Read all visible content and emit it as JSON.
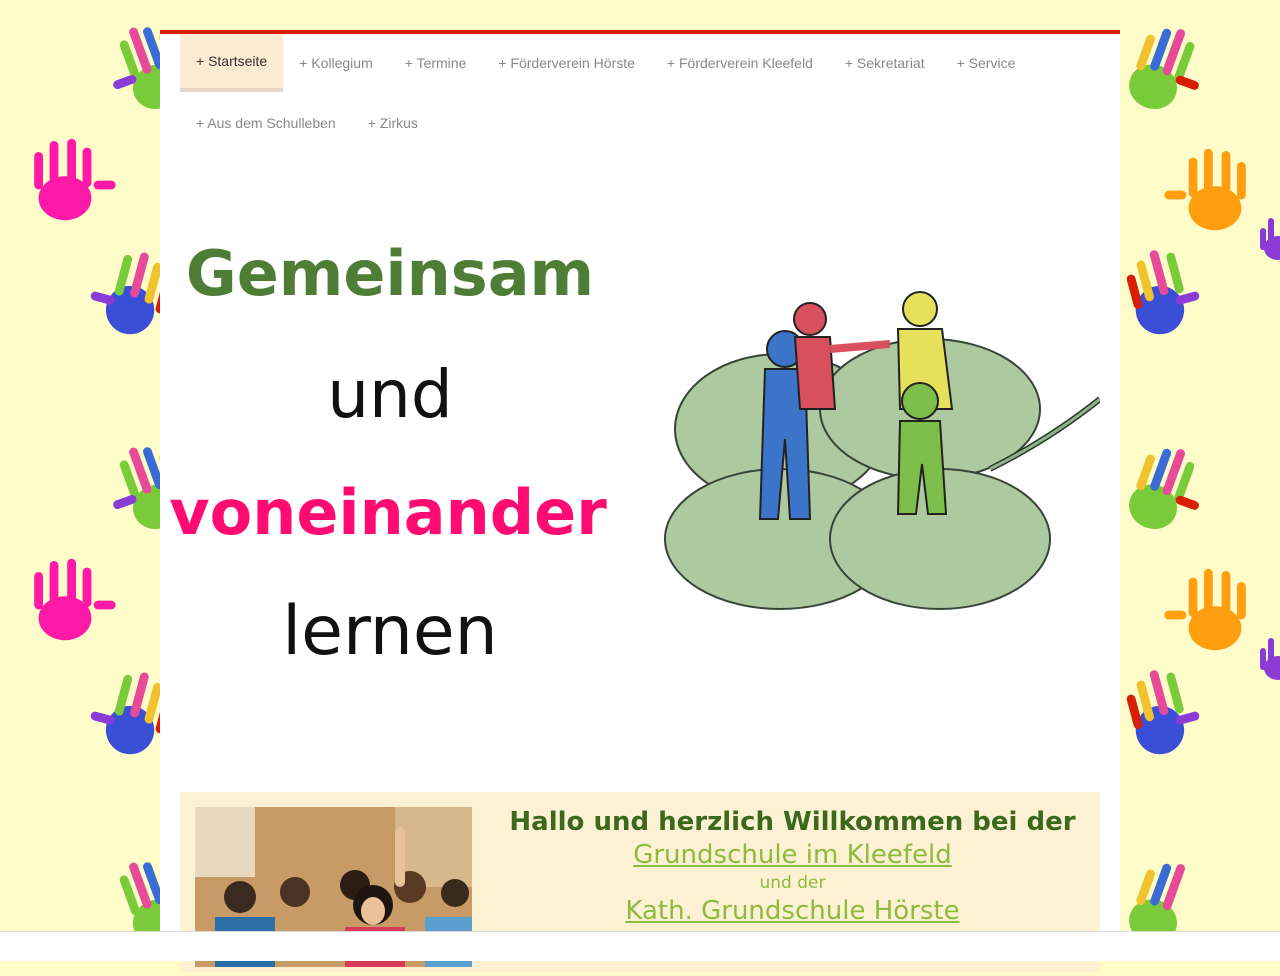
{
  "nav": {
    "items": [
      {
        "label": "+ Startseite",
        "active": true
      },
      {
        "label": "+ Kollegium"
      },
      {
        "label": "+ Termine"
      },
      {
        "label": "+ Förderverein Hörste"
      },
      {
        "label": "+ Förderverein Kleefeld"
      },
      {
        "label": "+ Sekretariat"
      },
      {
        "label": "+ Service"
      },
      {
        "label": "+ Aus dem Schulleben"
      },
      {
        "label": "+ Zirkus"
      }
    ]
  },
  "hero": {
    "slogan": [
      "Gemeinsam",
      "und",
      "voneinander",
      "lernen"
    ]
  },
  "welcome": {
    "heading": "Hallo und herzlich Willkommen bei der",
    "school_1": "Grundschule im Kleefeld",
    "connector": "und der",
    "school_2": "Kath. Grundschule Hörste"
  },
  "colors": {
    "accent_red": "#d81e05",
    "slogan_green": "#4e7e35",
    "slogan_pink": "#ff0b72",
    "link_green": "#8cbb3f",
    "background": "#fefcc8"
  }
}
